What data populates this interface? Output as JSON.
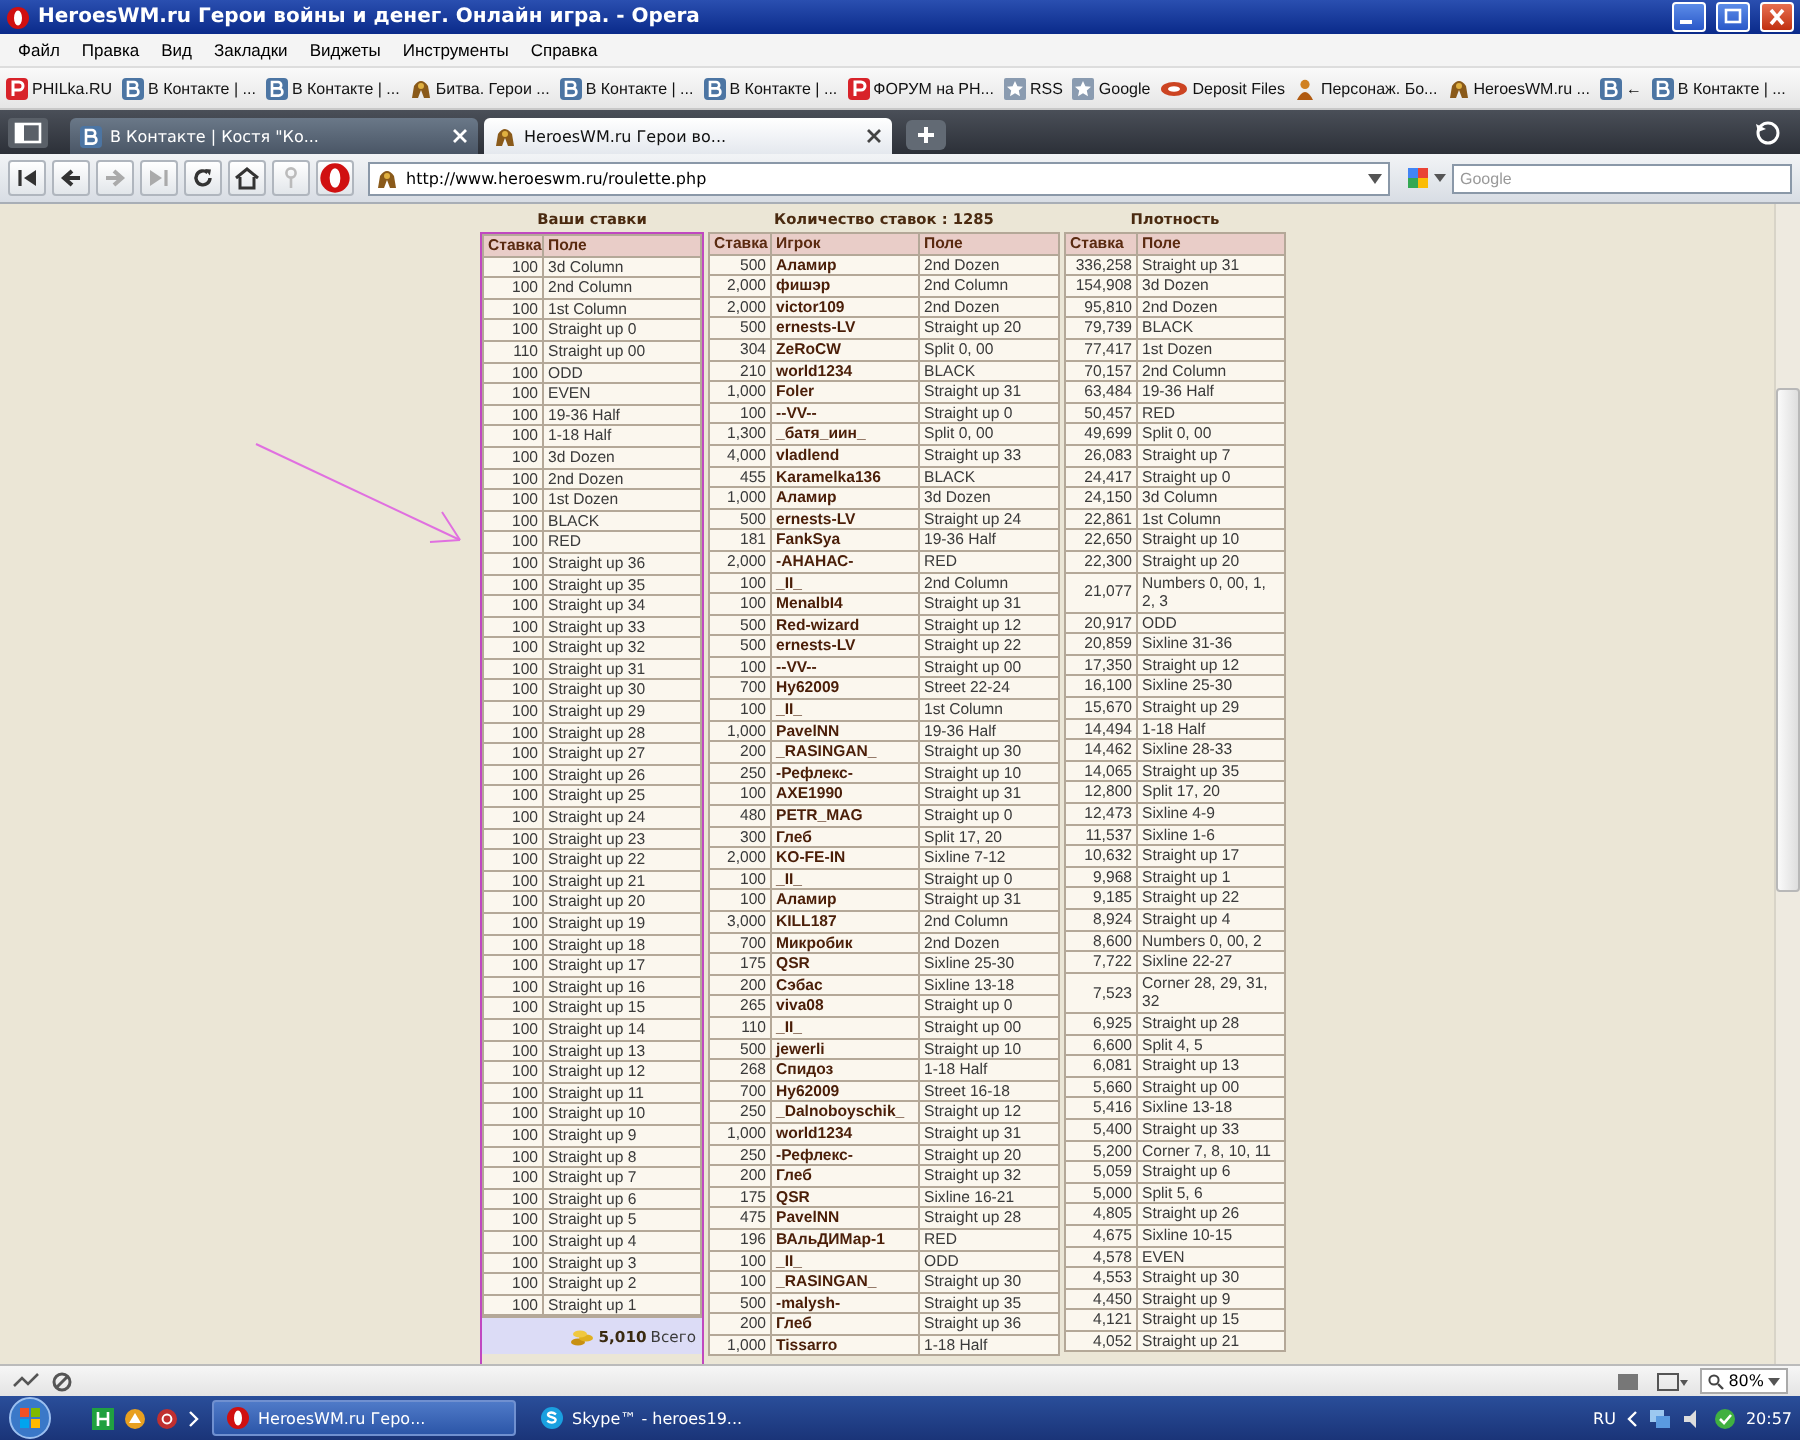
{
  "window": {
    "title": "HeroesWM.ru Герои войны и денег. Онлайн игра. - Opera"
  },
  "menu": [
    "Файл",
    "Правка",
    "Вид",
    "Закладки",
    "Виджеты",
    "Инструменты",
    "Справка"
  ],
  "bookmarks": [
    {
      "label": "PHILka.RU",
      "kind": "red"
    },
    {
      "label": "В Контакте | ...",
      "kind": "vk"
    },
    {
      "label": "В Контакте | ...",
      "kind": "vk"
    },
    {
      "label": "Битва. Герои ...",
      "kind": "helmet"
    },
    {
      "label": "В Контакте | ...",
      "kind": "vk"
    },
    {
      "label": "В Контакте | ...",
      "kind": "vk"
    },
    {
      "label": "ФОРУМ на РН...",
      "kind": "red"
    },
    {
      "label": "RSS",
      "kind": "star"
    },
    {
      "label": "Google",
      "kind": "star"
    },
    {
      "label": "Deposit Files",
      "kind": "disk"
    },
    {
      "label": "Персонаж. Бо...",
      "kind": "person"
    },
    {
      "label": "HeroesWM.ru ...",
      "kind": "helmet"
    },
    {
      "label": "←",
      "kind": "vk"
    },
    {
      "label": "В Контакте | ...",
      "kind": "vk"
    }
  ],
  "tabs": [
    {
      "label": "В Контакте | Костя \"Ко...",
      "selected": false,
      "kind": "vk"
    },
    {
      "label": "HeroesWM.ru Герои во...",
      "selected": true,
      "kind": "helmet"
    }
  ],
  "address": {
    "url": "http://www.heroeswm.ru/roulette.php"
  },
  "search": {
    "placeholder": "Google"
  },
  "page": {
    "your_bets": {
      "title": "Ваши ставки",
      "columns": [
        {
          "label": "Ставка",
          "kind": "amount"
        },
        {
          "label": "Поле",
          "kind": "field"
        }
      ],
      "rows": [
        [
          "100",
          "3d Column"
        ],
        [
          "100",
          "2nd Column"
        ],
        [
          "100",
          "1st Column"
        ],
        [
          "100",
          "Straight up 0"
        ],
        [
          "110",
          "Straight up 00"
        ],
        [
          "100",
          "ODD"
        ],
        [
          "100",
          "EVEN"
        ],
        [
          "100",
          "19-36 Half"
        ],
        [
          "100",
          "1-18 Half"
        ],
        [
          "100",
          "3d Dozen"
        ],
        [
          "100",
          "2nd Dozen"
        ],
        [
          "100",
          "1st Dozen"
        ],
        [
          "100",
          "BLACK"
        ],
        [
          "100",
          "RED"
        ],
        [
          "100",
          "Straight up 36"
        ],
        [
          "100",
          "Straight up 35"
        ],
        [
          "100",
          "Straight up 34"
        ],
        [
          "100",
          "Straight up 33"
        ],
        [
          "100",
          "Straight up 32"
        ],
        [
          "100",
          "Straight up 31"
        ],
        [
          "100",
          "Straight up 30"
        ],
        [
          "100",
          "Straight up 29"
        ],
        [
          "100",
          "Straight up 28"
        ],
        [
          "100",
          "Straight up 27"
        ],
        [
          "100",
          "Straight up 26"
        ],
        [
          "100",
          "Straight up 25"
        ],
        [
          "100",
          "Straight up 24"
        ],
        [
          "100",
          "Straight up 23"
        ],
        [
          "100",
          "Straight up 22"
        ],
        [
          "100",
          "Straight up 21"
        ],
        [
          "100",
          "Straight up 20"
        ],
        [
          "100",
          "Straight up 19"
        ],
        [
          "100",
          "Straight up 18"
        ],
        [
          "100",
          "Straight up 17"
        ],
        [
          "100",
          "Straight up 16"
        ],
        [
          "100",
          "Straight up 15"
        ],
        [
          "100",
          "Straight up 14"
        ],
        [
          "100",
          "Straight up 13"
        ],
        [
          "100",
          "Straight up 12"
        ],
        [
          "100",
          "Straight up 11"
        ],
        [
          "100",
          "Straight up 10"
        ],
        [
          "100",
          "Straight up 9"
        ],
        [
          "100",
          "Straight up 8"
        ],
        [
          "100",
          "Straight up 7"
        ],
        [
          "100",
          "Straight up 6"
        ],
        [
          "100",
          "Straight up 5"
        ],
        [
          "100",
          "Straight up 4"
        ],
        [
          "100",
          "Straight up 3"
        ],
        [
          "100",
          "Straight up 2"
        ],
        [
          "100",
          "Straight up 1"
        ]
      ],
      "total": {
        "amount": "5,010",
        "label": "Всего"
      }
    },
    "all_bets": {
      "title": "Количество ставок : 1285",
      "columns": [
        {
          "label": "Ставка",
          "kind": "amount"
        },
        {
          "label": "Игрок",
          "kind": "player"
        },
        {
          "label": "Поле",
          "kind": "field"
        }
      ],
      "rows": [
        [
          "500",
          "Аламир",
          "2nd Dozen"
        ],
        [
          "2,000",
          "фишэр",
          "2nd Column"
        ],
        [
          "2,000",
          "victor109",
          "2nd Dozen"
        ],
        [
          "500",
          "ernests-LV",
          "Straight up 20"
        ],
        [
          "304",
          "ZeRoCW",
          "Split 0, 00"
        ],
        [
          "210",
          "world1234",
          "BLACK"
        ],
        [
          "1,000",
          "Foler",
          "Straight up 31"
        ],
        [
          "100",
          "--VV--",
          "Straight up 0"
        ],
        [
          "1,300",
          "_батя_иин_",
          "Split 0, 00"
        ],
        [
          "4,000",
          "vladlend",
          "Straight up 33"
        ],
        [
          "455",
          "Karamelka136",
          "BLACK"
        ],
        [
          "1,000",
          "Аламир",
          "3d Dozen"
        ],
        [
          "500",
          "ernests-LV",
          "Straight up 24"
        ],
        [
          "181",
          "FankSya",
          "19-36 Half"
        ],
        [
          "2,000",
          "-АНАНАС-",
          "RED"
        ],
        [
          "100",
          "_II_",
          "2nd Column"
        ],
        [
          "100",
          "MenalbI4",
          "Straight up 31"
        ],
        [
          "500",
          "Red-wizard",
          "Straight up 12"
        ],
        [
          "500",
          "ernests-LV",
          "Straight up 22"
        ],
        [
          "100",
          "--VV--",
          "Straight up 00"
        ],
        [
          "700",
          "Ну62009",
          "Street 22-24"
        ],
        [
          "100",
          "_II_",
          "1st Column"
        ],
        [
          "1,000",
          "PavelNN",
          "19-36 Half"
        ],
        [
          "200",
          "_RASINGAN_",
          "Straight up 30"
        ],
        [
          "250",
          "-Рефлекс-",
          "Straight up 10"
        ],
        [
          "100",
          "AXE1990",
          "Straight up 31"
        ],
        [
          "480",
          "PETR_MAG",
          "Straight up 0"
        ],
        [
          "300",
          "Глеб",
          "Split 17, 20"
        ],
        [
          "2,000",
          "KO-FE-IN",
          "Sixline 7-12"
        ],
        [
          "100",
          "_II_",
          "Straight up 0"
        ],
        [
          "100",
          "Аламир",
          "Straight up 31"
        ],
        [
          "3,000",
          "KILL187",
          "2nd Column"
        ],
        [
          "700",
          "Микробик",
          "2nd Dozen"
        ],
        [
          "175",
          "QSR",
          "Sixline 25-30"
        ],
        [
          "200",
          "Сэбас",
          "Sixline 13-18"
        ],
        [
          "265",
          "viva08",
          "Straight up 0"
        ],
        [
          "110",
          "_II_",
          "Straight up 00"
        ],
        [
          "500",
          "jewerli",
          "Straight up 10"
        ],
        [
          "268",
          "Спидоз",
          "1-18 Half"
        ],
        [
          "700",
          "Ну62009",
          "Street 16-18"
        ],
        [
          "250",
          "_Dalnoboyschik_",
          "Straight up 12"
        ],
        [
          "1,000",
          "world1234",
          "Straight up 31"
        ],
        [
          "250",
          "-Рефлекс-",
          "Straight up 20"
        ],
        [
          "200",
          "Глеб",
          "Straight up 32"
        ],
        [
          "175",
          "QSR",
          "Sixline 16-21"
        ],
        [
          "475",
          "PavelNN",
          "Straight up 28"
        ],
        [
          "196",
          "ВАльДИМар-1",
          "RED"
        ],
        [
          "100",
          "_II_",
          "ODD"
        ],
        [
          "100",
          "_RASINGAN_",
          "Straight up 30"
        ],
        [
          "500",
          "-malysh-",
          "Straight up 35"
        ],
        [
          "200",
          "Глеб",
          "Straight up 36"
        ],
        [
          "1,000",
          "Tissarro",
          "1-18 Half"
        ]
      ]
    },
    "density": {
      "title": "Плотность",
      "columns": [
        {
          "label": "Ставка",
          "kind": "amount"
        },
        {
          "label": "Поле",
          "kind": "field"
        }
      ],
      "rows": [
        [
          "336,258",
          "Straight up 31"
        ],
        [
          "154,908",
          "3d Dozen"
        ],
        [
          "95,810",
          "2nd Dozen"
        ],
        [
          "79,739",
          "BLACK"
        ],
        [
          "77,417",
          "1st Dozen"
        ],
        [
          "70,157",
          "2nd Column"
        ],
        [
          "63,484",
          "19-36 Half"
        ],
        [
          "50,457",
          "RED"
        ],
        [
          "49,699",
          "Split 0, 00"
        ],
        [
          "26,083",
          "Straight up 7"
        ],
        [
          "24,417",
          "Straight up 0"
        ],
        [
          "24,150",
          "3d Column"
        ],
        [
          "22,861",
          "1st Column"
        ],
        [
          "22,650",
          "Straight up 10"
        ],
        [
          "22,300",
          "Straight up 20"
        ],
        [
          "21,077",
          "Numbers 0, 00, 1, 2, 3"
        ],
        [
          "20,917",
          "ODD"
        ],
        [
          "20,859",
          "Sixline 31-36"
        ],
        [
          "17,350",
          "Straight up 12"
        ],
        [
          "16,100",
          "Sixline 25-30"
        ],
        [
          "15,670",
          "Straight up 29"
        ],
        [
          "14,494",
          "1-18 Half"
        ],
        [
          "14,462",
          "Sixline 28-33"
        ],
        [
          "14,065",
          "Straight up 35"
        ],
        [
          "12,800",
          "Split 17, 20"
        ],
        [
          "12,473",
          "Sixline 4-9"
        ],
        [
          "11,537",
          "Sixline 1-6"
        ],
        [
          "10,632",
          "Straight up 17"
        ],
        [
          "9,968",
          "Straight up 1"
        ],
        [
          "9,185",
          "Straight up 22"
        ],
        [
          "8,924",
          "Straight up 4"
        ],
        [
          "8,600",
          "Numbers 0, 00, 2"
        ],
        [
          "7,722",
          "Sixline 22-27"
        ],
        [
          "7,523",
          "Corner 28, 29, 31, 32"
        ],
        [
          "6,925",
          "Straight up 28"
        ],
        [
          "6,600",
          "Split 4, 5"
        ],
        [
          "6,081",
          "Straight up 13"
        ],
        [
          "5,660",
          "Straight up 00"
        ],
        [
          "5,416",
          "Sixline 13-18"
        ],
        [
          "5,400",
          "Straight up 33"
        ],
        [
          "5,200",
          "Corner 7, 8, 10, 11"
        ],
        [
          "5,059",
          "Straight up 6"
        ],
        [
          "5,000",
          "Split 5, 6"
        ],
        [
          "4,805",
          "Straight up 26"
        ],
        [
          "4,675",
          "Sixline 10-15"
        ],
        [
          "4,578",
          "EVEN"
        ],
        [
          "4,553",
          "Straight up 30"
        ],
        [
          "4,450",
          "Straight up 9"
        ],
        [
          "4,121",
          "Straight up 15"
        ],
        [
          "4,052",
          "Straight up 21"
        ]
      ]
    }
  },
  "status_bar": {
    "zoom": "80%"
  },
  "taskbar": {
    "items": [
      {
        "label": "HeroesWM.ru Геро...",
        "selected": true,
        "kind": "opera"
      },
      {
        "label": "Skype™ - heroes19...",
        "selected": false,
        "kind": "skype"
      }
    ],
    "language": "RU",
    "clock": "20:57"
  }
}
